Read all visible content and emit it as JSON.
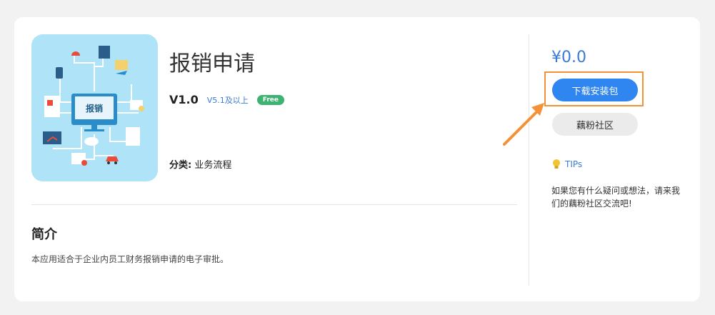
{
  "app": {
    "title": "报销申请",
    "version": "V1.0",
    "compat": "V5.1及以上",
    "badge": "Free",
    "icon_label": "报销",
    "category_label": "分类:",
    "category_value": "业务流程"
  },
  "intro": {
    "title": "简介",
    "text": "本应用适合于企业内员工财务报销申请的电子审批。"
  },
  "sidebar": {
    "price": "¥0.0",
    "download_label": "下载安装包",
    "community_label": "藕粉社区",
    "tips_label": "TIPs",
    "tips_text": "如果您有什么疑问或想法，请来我们的藕粉社区交流吧!"
  },
  "colors": {
    "accent": "#2f86f0",
    "link": "#3a7bd5",
    "free": "#3cb371",
    "highlight": "#f39237",
    "icon_bg": "#aee3f8"
  }
}
